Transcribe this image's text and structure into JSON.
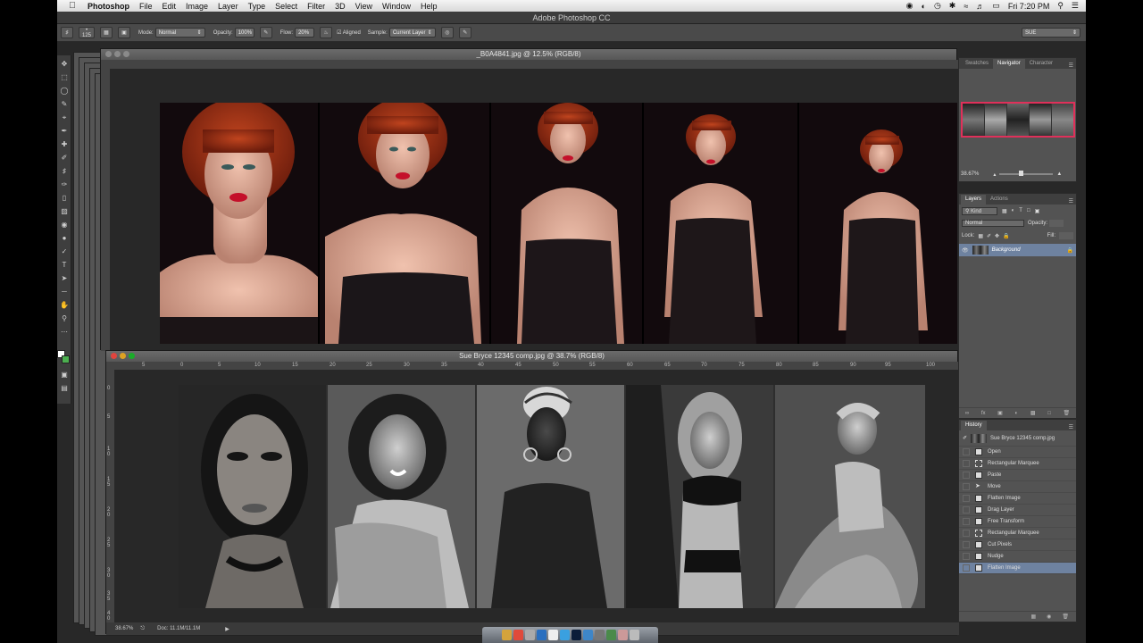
{
  "menubar": {
    "app_name": "Photoshop",
    "items": [
      "File",
      "Edit",
      "Image",
      "Layer",
      "Type",
      "Select",
      "Filter",
      "3D",
      "View",
      "Window",
      "Help"
    ],
    "clock": "Fri 7:20 PM"
  },
  "app_title": "Adobe Photoshop CC",
  "options_bar": {
    "brush_size": "125",
    "mode_label": "Mode:",
    "mode_value": "Normal",
    "opacity_label": "Opacity:",
    "opacity_value": "100%",
    "flow_label": "Flow:",
    "flow_value": "20%",
    "aligned_label": "Aligned",
    "sample_label": "Sample:",
    "sample_value": "Current Layer",
    "workspace_value": "SUE"
  },
  "doc_top": {
    "title": "_B0A4841.jpg @ 12.5% (RGB/8)"
  },
  "doc_bottom": {
    "title": "Sue Bryce 12345 comp.jpg @ 38.7% (RGB/8)",
    "ruler_labels": [
      "5",
      "0",
      "5",
      "10",
      "15",
      "20",
      "25",
      "30",
      "35",
      "40",
      "45",
      "50",
      "55",
      "60",
      "65",
      "70",
      "75",
      "80",
      "85",
      "90",
      "95",
      "100"
    ],
    "vruler_labels": [
      "0",
      "5",
      "1 0",
      "1 5",
      "2 0",
      "2 5",
      "3 0",
      "3 5",
      "4 0"
    ],
    "zoom": "38.67%",
    "doc_size": "Doc: 11.1M/11.1M"
  },
  "navigator": {
    "tabs": [
      "Swatches",
      "Navigator",
      "Character"
    ],
    "active_tab": "Navigator",
    "zoom": "38.67%"
  },
  "layers": {
    "tabs": [
      "Layers",
      "Actions"
    ],
    "filter_label": "Kind",
    "blend_mode": "Normal",
    "opacity_label": "Opacity:",
    "lock_label": "Lock:",
    "fill_label": "Fill:",
    "layer_name": "Background"
  },
  "history": {
    "tab": "History",
    "snapshot": "Sue Bryce 12345 comp.jpg",
    "items": [
      "Open",
      "Rectangular Marquee",
      "Paste",
      "Move",
      "Flatten Image",
      "Drag Layer",
      "Free Transform",
      "Rectangular Marquee",
      "Cut Pixels",
      "Nudge",
      "Flatten Image"
    ],
    "selected_index": 10
  },
  "colors": {
    "accent_selected": "#6e82a0",
    "navigator_frame": "#e0305a",
    "foreground_swatch": "#ffffff",
    "background_swatch": "#4caf50"
  }
}
